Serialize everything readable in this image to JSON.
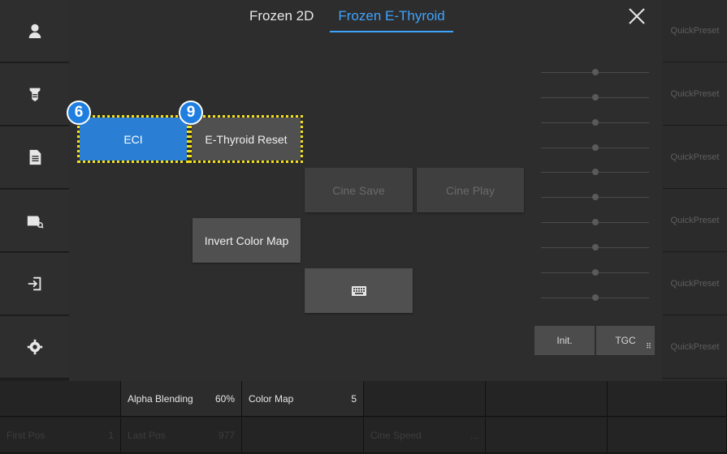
{
  "tabs": [
    {
      "label": "Frozen 2D",
      "active": false
    },
    {
      "label": "Frozen E-Thyroid",
      "active": true
    }
  ],
  "sidebar_icons": [
    "user-icon",
    "probe-icon",
    "report-icon",
    "image-review-icon",
    "exit-icon",
    "settings-icon"
  ],
  "buttons": {
    "eci": "ECI",
    "ethyroid_reset": "E-Thyroid Reset",
    "cine_save": "Cine Save",
    "cine_play": "Cine Play",
    "invert_color_map": "Invert Color Map",
    "keyboard": "keyboard-icon"
  },
  "badges": {
    "eci": "6",
    "ethyroid_reset": "9"
  },
  "tgc": {
    "init": "Init.",
    "tgc": "TGC"
  },
  "quickpresets": [
    "QuickPreset",
    "QuickPreset",
    "QuickPreset",
    "QuickPreset",
    "QuickPreset",
    "QuickPreset"
  ],
  "bottom_row1": [
    {
      "label": "",
      "value": ""
    },
    {
      "label": "Alpha Blending",
      "value": "60%"
    },
    {
      "label": "Color Map",
      "value": "5"
    },
    {
      "label": "",
      "value": ""
    },
    {
      "label": "",
      "value": ""
    },
    {
      "label": "",
      "value": ""
    }
  ],
  "bottom_row2": [
    {
      "label": "First Pos",
      "value": "1"
    },
    {
      "label": "Last Pos",
      "value": "977"
    },
    {
      "label": "",
      "value": ""
    },
    {
      "label": "Cine Speed",
      "value": "..."
    },
    {
      "label": "",
      "value": ""
    },
    {
      "label": "",
      "value": ""
    }
  ],
  "colors": {
    "accent": "#3fa4ff",
    "eci_blue": "#2a7fd4",
    "highlight": "#f3e11a"
  }
}
